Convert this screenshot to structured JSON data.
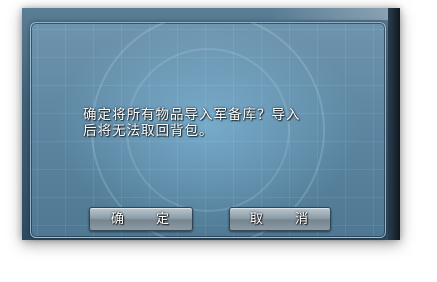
{
  "dialog": {
    "message_line1": "确定将所有物品导入军备库？导入",
    "message_line2": "后将无法取回背包。",
    "confirm_label": "确 定",
    "cancel_label": "取 消"
  },
  "colors": {
    "dialog_bg": "#5d87a2",
    "button_bg": "#8e9ea9",
    "text": "#ffffff"
  }
}
